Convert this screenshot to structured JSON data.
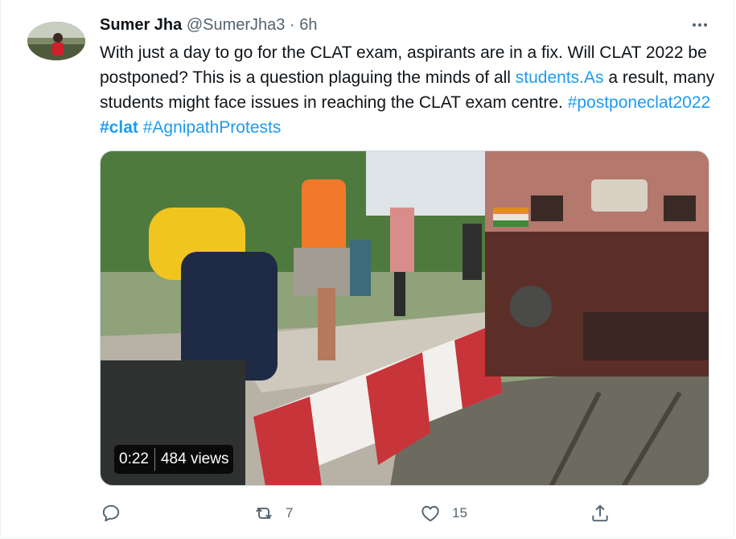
{
  "tweet": {
    "author_name": "Sumer Jha",
    "author_handle": "@SumerJha3",
    "separator": "·",
    "time": "6h",
    "text_part1": "With just a day to go for the CLAT exam, aspirants are in a fix. Will CLAT 2022 be postponed? This is a question plaguing the minds of all ",
    "link_students": "students.As",
    "text_part2": " a result, many students might face issues in reaching the CLAT exam centre. ",
    "hashtag1": "#postponeclat2022",
    "hashtag2": "#clat",
    "hashtag3": "#AgnipathProtests"
  },
  "video": {
    "duration": "0:22",
    "views": "484 views"
  },
  "actions": {
    "reply_icon": "reply-icon",
    "retweet_icon": "retweet-icon",
    "retweet_count": "7",
    "like_icon": "heart-icon",
    "like_count": "15",
    "share_icon": "share-icon"
  },
  "colors": {
    "link": "#1d9bf0",
    "muted": "#536471",
    "text": "#0f1419"
  }
}
